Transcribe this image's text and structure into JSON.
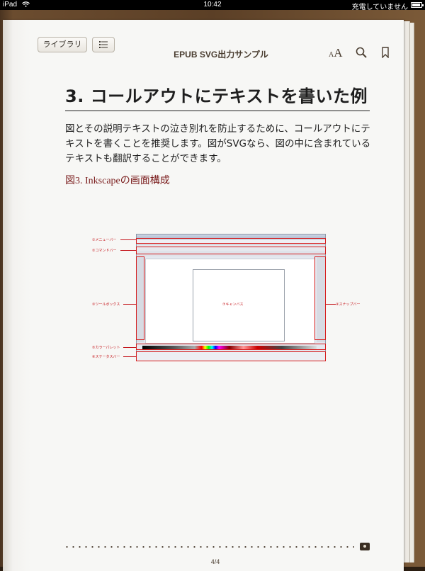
{
  "statusbar": {
    "carrier": "iPad",
    "time": "10:42",
    "battery_status": "充電していません",
    "battery_level": 0.8
  },
  "toolbar": {
    "library_label": "ライブラリ",
    "toc_icon": "list-icon",
    "title": "EPUB SVG出力サンプル",
    "font_small": "A",
    "font_big": "A",
    "search_icon": "search-icon",
    "bookmark_icon": "bookmark-icon"
  },
  "content": {
    "heading": "3. コールアウトにテキストを書いた例",
    "paragraph": "図とその説明テキストの泣き別れを防止するために、コールアウトにテキストを書くことを推奨します。図がSVGなら、図の中に含まれているテキストも翻訳することができます。",
    "figure_caption": "図3. Inkscapeの画面構成"
  },
  "figure": {
    "labels": {
      "menubar": "①メニューバー",
      "commandbar": "②コマンドバー",
      "toolbox": "③ツールボックス",
      "canvas": "⑦キャンバス",
      "snapbar": "④スナップバー",
      "palette": "⑤カラーパレット",
      "statusbar": "⑥ステータスバー"
    }
  },
  "footer": {
    "page_indicator": "4/4",
    "progress": 0.99
  },
  "colors": {
    "caption": "#7b1e1e",
    "callout": "#c4141a",
    "page": "#f7f7f5",
    "binding": "#5b3f26"
  }
}
